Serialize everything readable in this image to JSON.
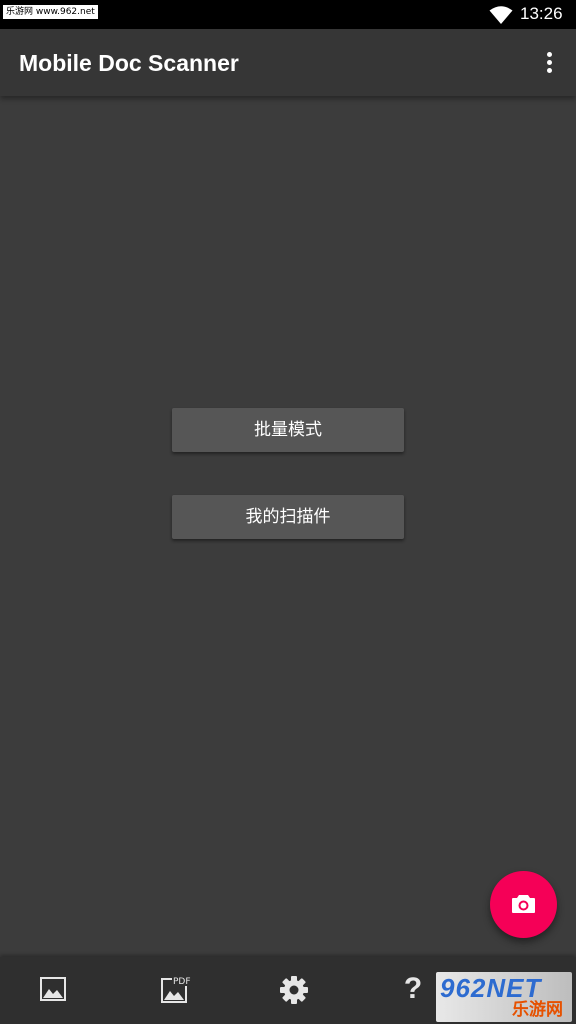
{
  "status_bar": {
    "watermark": "乐游网 www.962.net",
    "time": "13:26"
  },
  "app_bar": {
    "title": "Mobile Doc Scanner",
    "overflow_icon": "more-vert-icon"
  },
  "main": {
    "batch_mode_label": "批量模式",
    "my_scans_label": "我的扫描件"
  },
  "fab": {
    "icon": "camera-icon",
    "color": "#f50057"
  },
  "bottom_bar": {
    "items": [
      {
        "icon": "image-icon"
      },
      {
        "icon": "pdf-icon",
        "badge": "PDF"
      },
      {
        "icon": "gear-icon"
      },
      {
        "icon": "help-icon",
        "glyph": "?"
      }
    ]
  },
  "watermark_logo": {
    "main": "962NET",
    "sub": "乐游网"
  },
  "colors": {
    "background": "#3c3c3c",
    "app_bar": "#363636",
    "button": "#565656",
    "accent": "#f50057"
  }
}
